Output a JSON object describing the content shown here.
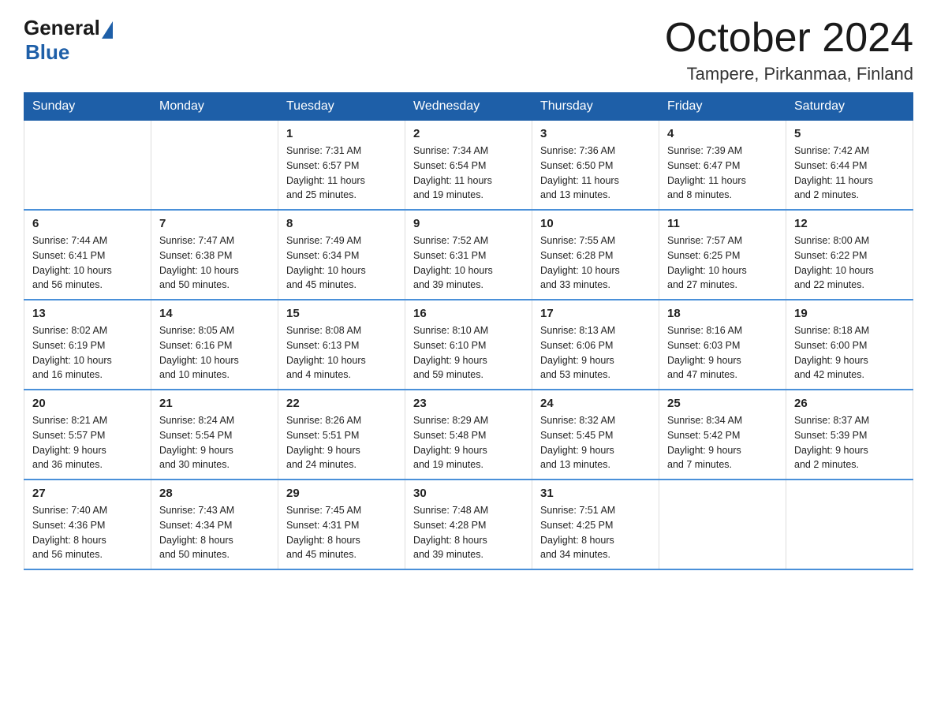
{
  "logo": {
    "general": "General",
    "blue": "Blue",
    "triangle": "▶"
  },
  "title": "October 2024",
  "location": "Tampere, Pirkanmaa, Finland",
  "weekdays": [
    "Sunday",
    "Monday",
    "Tuesday",
    "Wednesday",
    "Thursday",
    "Friday",
    "Saturday"
  ],
  "weeks": [
    [
      {
        "day": "",
        "info": ""
      },
      {
        "day": "",
        "info": ""
      },
      {
        "day": "1",
        "info": "Sunrise: 7:31 AM\nSunset: 6:57 PM\nDaylight: 11 hours\nand 25 minutes."
      },
      {
        "day": "2",
        "info": "Sunrise: 7:34 AM\nSunset: 6:54 PM\nDaylight: 11 hours\nand 19 minutes."
      },
      {
        "day": "3",
        "info": "Sunrise: 7:36 AM\nSunset: 6:50 PM\nDaylight: 11 hours\nand 13 minutes."
      },
      {
        "day": "4",
        "info": "Sunrise: 7:39 AM\nSunset: 6:47 PM\nDaylight: 11 hours\nand 8 minutes."
      },
      {
        "day": "5",
        "info": "Sunrise: 7:42 AM\nSunset: 6:44 PM\nDaylight: 11 hours\nand 2 minutes."
      }
    ],
    [
      {
        "day": "6",
        "info": "Sunrise: 7:44 AM\nSunset: 6:41 PM\nDaylight: 10 hours\nand 56 minutes."
      },
      {
        "day": "7",
        "info": "Sunrise: 7:47 AM\nSunset: 6:38 PM\nDaylight: 10 hours\nand 50 minutes."
      },
      {
        "day": "8",
        "info": "Sunrise: 7:49 AM\nSunset: 6:34 PM\nDaylight: 10 hours\nand 45 minutes."
      },
      {
        "day": "9",
        "info": "Sunrise: 7:52 AM\nSunset: 6:31 PM\nDaylight: 10 hours\nand 39 minutes."
      },
      {
        "day": "10",
        "info": "Sunrise: 7:55 AM\nSunset: 6:28 PM\nDaylight: 10 hours\nand 33 minutes."
      },
      {
        "day": "11",
        "info": "Sunrise: 7:57 AM\nSunset: 6:25 PM\nDaylight: 10 hours\nand 27 minutes."
      },
      {
        "day": "12",
        "info": "Sunrise: 8:00 AM\nSunset: 6:22 PM\nDaylight: 10 hours\nand 22 minutes."
      }
    ],
    [
      {
        "day": "13",
        "info": "Sunrise: 8:02 AM\nSunset: 6:19 PM\nDaylight: 10 hours\nand 16 minutes."
      },
      {
        "day": "14",
        "info": "Sunrise: 8:05 AM\nSunset: 6:16 PM\nDaylight: 10 hours\nand 10 minutes."
      },
      {
        "day": "15",
        "info": "Sunrise: 8:08 AM\nSunset: 6:13 PM\nDaylight: 10 hours\nand 4 minutes."
      },
      {
        "day": "16",
        "info": "Sunrise: 8:10 AM\nSunset: 6:10 PM\nDaylight: 9 hours\nand 59 minutes."
      },
      {
        "day": "17",
        "info": "Sunrise: 8:13 AM\nSunset: 6:06 PM\nDaylight: 9 hours\nand 53 minutes."
      },
      {
        "day": "18",
        "info": "Sunrise: 8:16 AM\nSunset: 6:03 PM\nDaylight: 9 hours\nand 47 minutes."
      },
      {
        "day": "19",
        "info": "Sunrise: 8:18 AM\nSunset: 6:00 PM\nDaylight: 9 hours\nand 42 minutes."
      }
    ],
    [
      {
        "day": "20",
        "info": "Sunrise: 8:21 AM\nSunset: 5:57 PM\nDaylight: 9 hours\nand 36 minutes."
      },
      {
        "day": "21",
        "info": "Sunrise: 8:24 AM\nSunset: 5:54 PM\nDaylight: 9 hours\nand 30 minutes."
      },
      {
        "day": "22",
        "info": "Sunrise: 8:26 AM\nSunset: 5:51 PM\nDaylight: 9 hours\nand 24 minutes."
      },
      {
        "day": "23",
        "info": "Sunrise: 8:29 AM\nSunset: 5:48 PM\nDaylight: 9 hours\nand 19 minutes."
      },
      {
        "day": "24",
        "info": "Sunrise: 8:32 AM\nSunset: 5:45 PM\nDaylight: 9 hours\nand 13 minutes."
      },
      {
        "day": "25",
        "info": "Sunrise: 8:34 AM\nSunset: 5:42 PM\nDaylight: 9 hours\nand 7 minutes."
      },
      {
        "day": "26",
        "info": "Sunrise: 8:37 AM\nSunset: 5:39 PM\nDaylight: 9 hours\nand 2 minutes."
      }
    ],
    [
      {
        "day": "27",
        "info": "Sunrise: 7:40 AM\nSunset: 4:36 PM\nDaylight: 8 hours\nand 56 minutes."
      },
      {
        "day": "28",
        "info": "Sunrise: 7:43 AM\nSunset: 4:34 PM\nDaylight: 8 hours\nand 50 minutes."
      },
      {
        "day": "29",
        "info": "Sunrise: 7:45 AM\nSunset: 4:31 PM\nDaylight: 8 hours\nand 45 minutes."
      },
      {
        "day": "30",
        "info": "Sunrise: 7:48 AM\nSunset: 4:28 PM\nDaylight: 8 hours\nand 39 minutes."
      },
      {
        "day": "31",
        "info": "Sunrise: 7:51 AM\nSunset: 4:25 PM\nDaylight: 8 hours\nand 34 minutes."
      },
      {
        "day": "",
        "info": ""
      },
      {
        "day": "",
        "info": ""
      }
    ]
  ]
}
